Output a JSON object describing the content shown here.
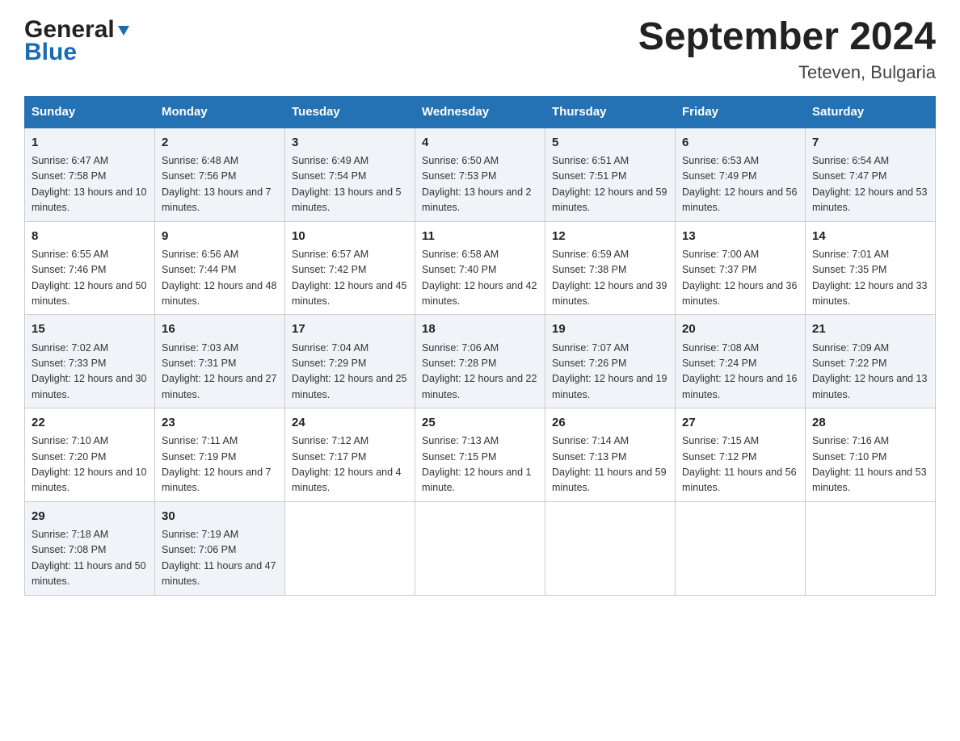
{
  "header": {
    "logo_general": "General",
    "logo_blue": "Blue",
    "month_title": "September 2024",
    "location": "Teteven, Bulgaria"
  },
  "weekdays": [
    "Sunday",
    "Monday",
    "Tuesday",
    "Wednesday",
    "Thursday",
    "Friday",
    "Saturday"
  ],
  "weeks": [
    [
      {
        "day": "1",
        "sunrise": "Sunrise: 6:47 AM",
        "sunset": "Sunset: 7:58 PM",
        "daylight": "Daylight: 13 hours and 10 minutes."
      },
      {
        "day": "2",
        "sunrise": "Sunrise: 6:48 AM",
        "sunset": "Sunset: 7:56 PM",
        "daylight": "Daylight: 13 hours and 7 minutes."
      },
      {
        "day": "3",
        "sunrise": "Sunrise: 6:49 AM",
        "sunset": "Sunset: 7:54 PM",
        "daylight": "Daylight: 13 hours and 5 minutes."
      },
      {
        "day": "4",
        "sunrise": "Sunrise: 6:50 AM",
        "sunset": "Sunset: 7:53 PM",
        "daylight": "Daylight: 13 hours and 2 minutes."
      },
      {
        "day": "5",
        "sunrise": "Sunrise: 6:51 AM",
        "sunset": "Sunset: 7:51 PM",
        "daylight": "Daylight: 12 hours and 59 minutes."
      },
      {
        "day": "6",
        "sunrise": "Sunrise: 6:53 AM",
        "sunset": "Sunset: 7:49 PM",
        "daylight": "Daylight: 12 hours and 56 minutes."
      },
      {
        "day": "7",
        "sunrise": "Sunrise: 6:54 AM",
        "sunset": "Sunset: 7:47 PM",
        "daylight": "Daylight: 12 hours and 53 minutes."
      }
    ],
    [
      {
        "day": "8",
        "sunrise": "Sunrise: 6:55 AM",
        "sunset": "Sunset: 7:46 PM",
        "daylight": "Daylight: 12 hours and 50 minutes."
      },
      {
        "day": "9",
        "sunrise": "Sunrise: 6:56 AM",
        "sunset": "Sunset: 7:44 PM",
        "daylight": "Daylight: 12 hours and 48 minutes."
      },
      {
        "day": "10",
        "sunrise": "Sunrise: 6:57 AM",
        "sunset": "Sunset: 7:42 PM",
        "daylight": "Daylight: 12 hours and 45 minutes."
      },
      {
        "day": "11",
        "sunrise": "Sunrise: 6:58 AM",
        "sunset": "Sunset: 7:40 PM",
        "daylight": "Daylight: 12 hours and 42 minutes."
      },
      {
        "day": "12",
        "sunrise": "Sunrise: 6:59 AM",
        "sunset": "Sunset: 7:38 PM",
        "daylight": "Daylight: 12 hours and 39 minutes."
      },
      {
        "day": "13",
        "sunrise": "Sunrise: 7:00 AM",
        "sunset": "Sunset: 7:37 PM",
        "daylight": "Daylight: 12 hours and 36 minutes."
      },
      {
        "day": "14",
        "sunrise": "Sunrise: 7:01 AM",
        "sunset": "Sunset: 7:35 PM",
        "daylight": "Daylight: 12 hours and 33 minutes."
      }
    ],
    [
      {
        "day": "15",
        "sunrise": "Sunrise: 7:02 AM",
        "sunset": "Sunset: 7:33 PM",
        "daylight": "Daylight: 12 hours and 30 minutes."
      },
      {
        "day": "16",
        "sunrise": "Sunrise: 7:03 AM",
        "sunset": "Sunset: 7:31 PM",
        "daylight": "Daylight: 12 hours and 27 minutes."
      },
      {
        "day": "17",
        "sunrise": "Sunrise: 7:04 AM",
        "sunset": "Sunset: 7:29 PM",
        "daylight": "Daylight: 12 hours and 25 minutes."
      },
      {
        "day": "18",
        "sunrise": "Sunrise: 7:06 AM",
        "sunset": "Sunset: 7:28 PM",
        "daylight": "Daylight: 12 hours and 22 minutes."
      },
      {
        "day": "19",
        "sunrise": "Sunrise: 7:07 AM",
        "sunset": "Sunset: 7:26 PM",
        "daylight": "Daylight: 12 hours and 19 minutes."
      },
      {
        "day": "20",
        "sunrise": "Sunrise: 7:08 AM",
        "sunset": "Sunset: 7:24 PM",
        "daylight": "Daylight: 12 hours and 16 minutes."
      },
      {
        "day": "21",
        "sunrise": "Sunrise: 7:09 AM",
        "sunset": "Sunset: 7:22 PM",
        "daylight": "Daylight: 12 hours and 13 minutes."
      }
    ],
    [
      {
        "day": "22",
        "sunrise": "Sunrise: 7:10 AM",
        "sunset": "Sunset: 7:20 PM",
        "daylight": "Daylight: 12 hours and 10 minutes."
      },
      {
        "day": "23",
        "sunrise": "Sunrise: 7:11 AM",
        "sunset": "Sunset: 7:19 PM",
        "daylight": "Daylight: 12 hours and 7 minutes."
      },
      {
        "day": "24",
        "sunrise": "Sunrise: 7:12 AM",
        "sunset": "Sunset: 7:17 PM",
        "daylight": "Daylight: 12 hours and 4 minutes."
      },
      {
        "day": "25",
        "sunrise": "Sunrise: 7:13 AM",
        "sunset": "Sunset: 7:15 PM",
        "daylight": "Daylight: 12 hours and 1 minute."
      },
      {
        "day": "26",
        "sunrise": "Sunrise: 7:14 AM",
        "sunset": "Sunset: 7:13 PM",
        "daylight": "Daylight: 11 hours and 59 minutes."
      },
      {
        "day": "27",
        "sunrise": "Sunrise: 7:15 AM",
        "sunset": "Sunset: 7:12 PM",
        "daylight": "Daylight: 11 hours and 56 minutes."
      },
      {
        "day": "28",
        "sunrise": "Sunrise: 7:16 AM",
        "sunset": "Sunset: 7:10 PM",
        "daylight": "Daylight: 11 hours and 53 minutes."
      }
    ],
    [
      {
        "day": "29",
        "sunrise": "Sunrise: 7:18 AM",
        "sunset": "Sunset: 7:08 PM",
        "daylight": "Daylight: 11 hours and 50 minutes."
      },
      {
        "day": "30",
        "sunrise": "Sunrise: 7:19 AM",
        "sunset": "Sunset: 7:06 PM",
        "daylight": "Daylight: 11 hours and 47 minutes."
      },
      null,
      null,
      null,
      null,
      null
    ]
  ]
}
